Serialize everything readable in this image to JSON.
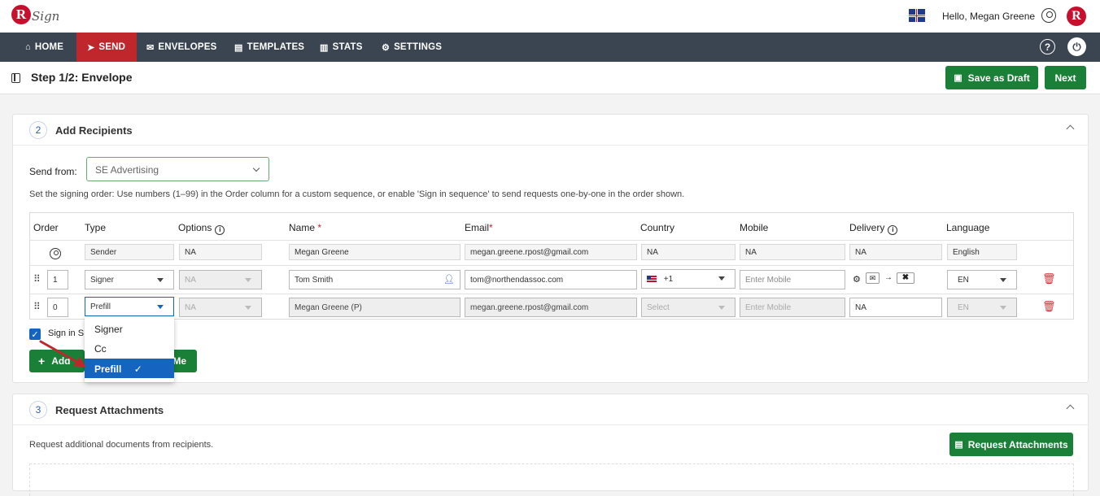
{
  "topbar": {
    "logo_letter": "R",
    "logo_text": "Sign",
    "greeting": "Hello, Megan Greene",
    "avatar_letter": "R"
  },
  "nav": {
    "items": [
      {
        "label": "HOME",
        "icon": "home-icon",
        "glyph": "⌂"
      },
      {
        "label": "SEND",
        "icon": "send-icon",
        "glyph": "➤"
      },
      {
        "label": "ENVELOPES",
        "icon": "envelope-icon",
        "glyph": "✉"
      },
      {
        "label": "TEMPLATES",
        "icon": "template-icon",
        "glyph": "▤"
      },
      {
        "label": "STATS",
        "icon": "stats-icon",
        "glyph": "▥"
      },
      {
        "label": "SETTINGS",
        "icon": "gear-icon",
        "glyph": "⚙"
      }
    ],
    "active": "SEND",
    "help_glyph": "?",
    "power_glyph": "⏻"
  },
  "step": {
    "title": "Step 1/2: Envelope",
    "save_draft": "Save as Draft",
    "next": "Next"
  },
  "recipients": {
    "number": "2",
    "title": "Add Recipients",
    "send_from_label": "Send from:",
    "send_from_value": "SE Advertising",
    "instructions": "Set the signing order: Use numbers (1–99) in the Order column for a custom sequence, or enable 'Sign in sequence' to send requests one-by-one in the order shown.",
    "columns": {
      "order": "Order",
      "type": "Type",
      "options": "Options",
      "name": "Name",
      "email": "Email",
      "country": "Country",
      "mobile": "Mobile",
      "delivery": "Delivery",
      "language": "Language"
    },
    "required_mark": "*",
    "rows": [
      {
        "order": "",
        "type": "Sender",
        "options": "NA",
        "name": "Megan Greene",
        "email": "megan.greene.rpost@gmail.com",
        "country": "NA",
        "mobile": "NA",
        "delivery": "NA",
        "language": "English"
      },
      {
        "order": "1",
        "type": "Signer",
        "options": "NA",
        "name": "Tom Smith",
        "email": "tom@northendassoc.com",
        "country": "+1",
        "mobile_placeholder": "Enter Mobile",
        "delivery": "",
        "language": "EN"
      },
      {
        "order": "0",
        "type": "Prefill",
        "options": "NA",
        "name": "Megan Greene (P)",
        "email": "megan.greene.rpost@gmail.com",
        "country": "Select",
        "mobile_placeholder": "Enter Mobile",
        "delivery": "NA",
        "language": "EN"
      }
    ],
    "sign_in_sequence_label": "Sign in S",
    "add_button": "Add",
    "me_button_tail": "Me",
    "type_options": [
      "Signer",
      "Cc",
      "Prefill"
    ],
    "selected_type": "Prefill"
  },
  "attachments": {
    "number": "3",
    "title": "Request Attachments",
    "description": "Request additional documents from recipients.",
    "button": "Request Attachments"
  },
  "colors": {
    "nav_bg": "#3b4451",
    "nav_active": "#c0272d",
    "primary_green": "#1a7f37",
    "select_blue": "#1565c0",
    "brand_red": "#c8102e"
  }
}
